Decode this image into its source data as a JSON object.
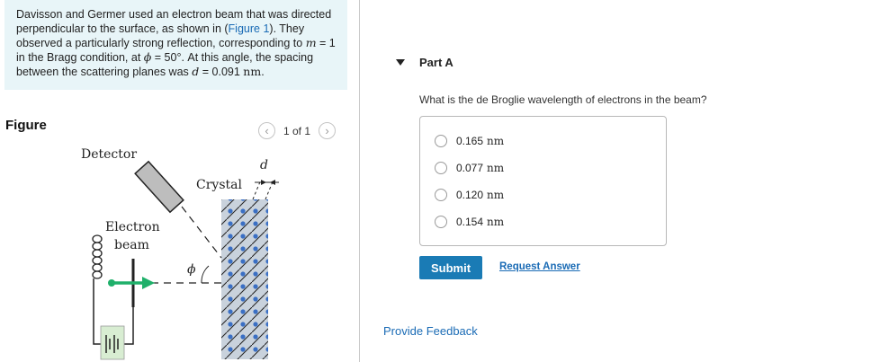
{
  "problem": {
    "p1": "Davisson and Germer used an electron beam that was directed perpendicular to the surface, as shown in (",
    "figure_link": "Figure 1",
    "p2": "). They observed a particularly strong reflection, corresponding to ",
    "m_var": "m",
    "p3": " = 1 in the Bragg condition, at ",
    "phi_var": "ϕ",
    "p4": " = 50°. At this angle, the spacing between the scattering planes was ",
    "d_var": "d",
    "p5": " = 0.091 ",
    "unit": "nm",
    "p6": "."
  },
  "figure": {
    "label": "Figure",
    "pager_text": "1 of 1",
    "prev_icon": "chevron-left-icon",
    "next_icon": "chevron-right-icon",
    "detector_label": "Detector",
    "crystal_label": "Crystal",
    "electron_label": "Electron",
    "beam_label": "beam",
    "d_label": "d",
    "phi_label": "ϕ"
  },
  "part_a": {
    "title": "Part A",
    "question": "What is the de Broglie wavelength of electrons in the beam?",
    "options": [
      {
        "value": "0.165",
        "unit": "nm"
      },
      {
        "value": "0.077",
        "unit": "nm"
      },
      {
        "value": "0.120",
        "unit": "nm"
      },
      {
        "value": "0.154",
        "unit": "nm"
      }
    ],
    "submit_label": "Submit",
    "request_answer_label": "Request Answer"
  },
  "feedback_label": "Provide Feedback",
  "colors": {
    "problem_bg": "#e8f5f8",
    "link": "#1a6bb5",
    "submit_bg": "#1a7bb5",
    "beam_arrow": "#1fb06a",
    "crystal_atom": "#3a6fc4"
  }
}
